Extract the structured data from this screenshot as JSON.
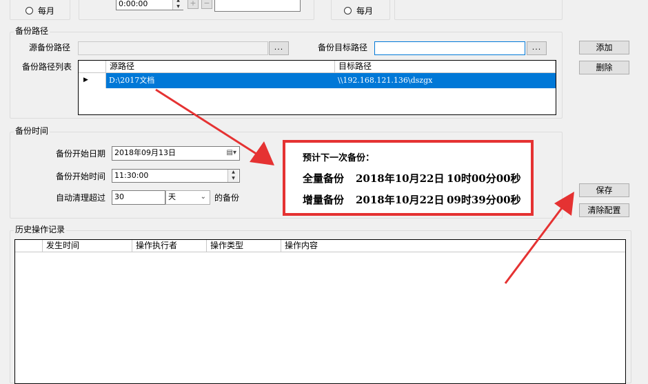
{
  "top": {
    "radio_monthly_left": "每月",
    "radio_monthly_right": "每月",
    "time_value": "0:00:00",
    "plus_label": "+",
    "minus_label": "−"
  },
  "backup_path": {
    "legend": "备份路径",
    "source_label": "源备份路径",
    "source_value": "",
    "target_label": "备份目标路径",
    "target_value": "",
    "browse_label": "...",
    "list_label": "备份路径列表",
    "columns": [
      "源路径",
      "目标路径"
    ],
    "rows": [
      {
        "source": "D:\\2017文档",
        "target": "\\\\192.168.121.136\\dszgx"
      }
    ],
    "add_button": "添加",
    "delete_button": "删除"
  },
  "backup_time": {
    "legend": "备份时间",
    "start_date_label": "备份开始日期",
    "start_date_value": "2018年09月13日",
    "start_time_label": "备份开始时间",
    "start_time_value": "11:30:00",
    "cleanup_label": "自动清理超过",
    "cleanup_value": "30",
    "cleanup_unit": "天",
    "cleanup_suffix": "的备份"
  },
  "actions": {
    "save_button": "保存",
    "clear_button": "清除配置"
  },
  "history": {
    "legend": "历史操作记录",
    "columns": [
      "发生时间",
      "操作执行者",
      "操作类型",
      "操作内容"
    ]
  },
  "callout": {
    "title": "预计下一次备份：",
    "full_label": "全量备份",
    "full_date": "2018年10月22日",
    "full_time": "10时00分00秒",
    "inc_label": "增量备份",
    "inc_date": "2018年10月22日",
    "inc_time": "09时39分00秒"
  },
  "colors": {
    "selection": "#0078d7",
    "annotation_red": "#e53232"
  }
}
